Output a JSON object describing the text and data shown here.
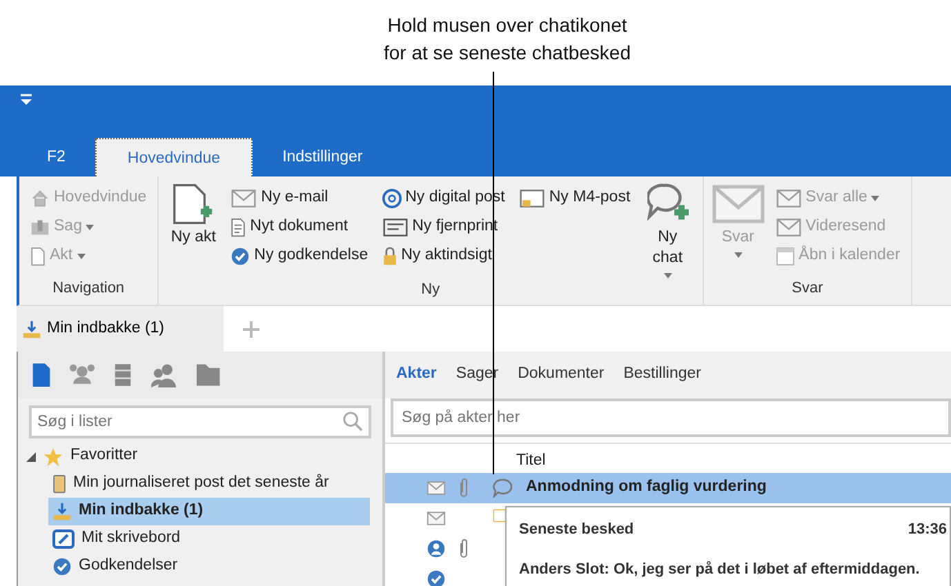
{
  "callout": {
    "lines": [
      "Hold musen over chatikonet",
      "for at se seneste chatbesked"
    ]
  },
  "ribbon_tabs": [
    {
      "label": "F2",
      "selected": false
    },
    {
      "label": "Hovedvindue",
      "selected": true
    },
    {
      "label": "Indstillinger",
      "selected": false
    }
  ],
  "ribbon_groups": [
    {
      "label": "Navigation",
      "columns": [
        {
          "kind": "small",
          "items": [
            {
              "label": "Hovedvindue",
              "disabled": true,
              "dropdown": false
            },
            {
              "label": "Sag",
              "disabled": true,
              "dropdown": true
            },
            {
              "label": "Akt",
              "disabled": true,
              "dropdown": true
            }
          ]
        }
      ]
    },
    {
      "label": "Ny",
      "columns": [
        {
          "kind": "big",
          "items": [
            {
              "label": "Ny akt",
              "disabled": false,
              "dropdown": false
            }
          ]
        },
        {
          "kind": "small",
          "items": [
            {
              "label": "Ny e-mail",
              "disabled": false,
              "dropdown": false
            },
            {
              "label": "Nyt dokument",
              "disabled": false,
              "dropdown": false
            },
            {
              "label": "Ny godkendelse",
              "disabled": false,
              "dropdown": false
            }
          ]
        },
        {
          "kind": "small",
          "items": [
            {
              "label": "Ny digital post",
              "disabled": false,
              "dropdown": false
            },
            {
              "label": "Ny fjernprint",
              "disabled": false,
              "dropdown": false
            },
            {
              "label": "Ny aktindsigt",
              "disabled": false,
              "dropdown": false
            }
          ]
        },
        {
          "kind": "small",
          "items": [
            {
              "label": "Ny M4-post",
              "disabled": false,
              "dropdown": false
            }
          ]
        },
        {
          "kind": "big",
          "items": [
            {
              "label": "Ny chat",
              "disabled": false,
              "dropdown": true
            }
          ]
        }
      ]
    },
    {
      "label": "Svar",
      "columns": [
        {
          "kind": "big",
          "items": [
            {
              "label": "Svar",
              "disabled": true,
              "dropdown": true
            }
          ]
        },
        {
          "kind": "small",
          "items": [
            {
              "label": "Svar alle",
              "disabled": true,
              "dropdown": true
            },
            {
              "label": "Videresend",
              "disabled": true,
              "dropdown": false
            },
            {
              "label": "Åbn i kalender",
              "disabled": true,
              "dropdown": false
            }
          ]
        }
      ]
    }
  ],
  "document_tabs": [
    {
      "label": "Min indbakke (1)",
      "selected": true
    }
  ],
  "left_panel": {
    "icons": [
      {
        "selected": true
      },
      {
        "selected": false
      },
      {
        "selected": false
      },
      {
        "selected": false
      },
      {
        "selected": false
      }
    ],
    "search": {
      "placeholder": "Søg i lister"
    },
    "tree": [
      {
        "label": "Favoritter",
        "expanded": true,
        "children": [
          {
            "label": "Min journaliseret post det seneste år",
            "selected": false
          },
          {
            "label": "Min indbakke (1)",
            "selected": true
          },
          {
            "label": "Mit skrivebord",
            "selected": false
          },
          {
            "label": "Godkendelser",
            "selected": false
          }
        ]
      }
    ]
  },
  "right_panel": {
    "tabs": [
      {
        "label": "Akter",
        "selected": true
      },
      {
        "label": "Sager",
        "selected": false
      },
      {
        "label": "Dokumenter",
        "selected": false
      },
      {
        "label": "Bestillinger",
        "selected": false
      }
    ],
    "search": {
      "placeholder": "Søg på akter her"
    },
    "columns": [
      "Titel"
    ],
    "rows": [
      {
        "kind": "email",
        "attachment": true,
        "chat": true,
        "note": false,
        "title": "Anmodning om faglig vurdering",
        "selected": true
      },
      {
        "kind": "email",
        "attachment": false,
        "chat": false,
        "note": true,
        "selected": false
      },
      {
        "kind": "person",
        "attachment": true,
        "chat": false,
        "note": false,
        "selected": false
      },
      {
        "kind": "approval",
        "attachment": false,
        "chat": false,
        "note": false,
        "selected": false
      }
    ]
  },
  "tooltip": {
    "heading": "Seneste besked",
    "time": "13:36",
    "message": "Anders Slot: Ok, jeg ser på det i løbet af eftermiddagen."
  }
}
